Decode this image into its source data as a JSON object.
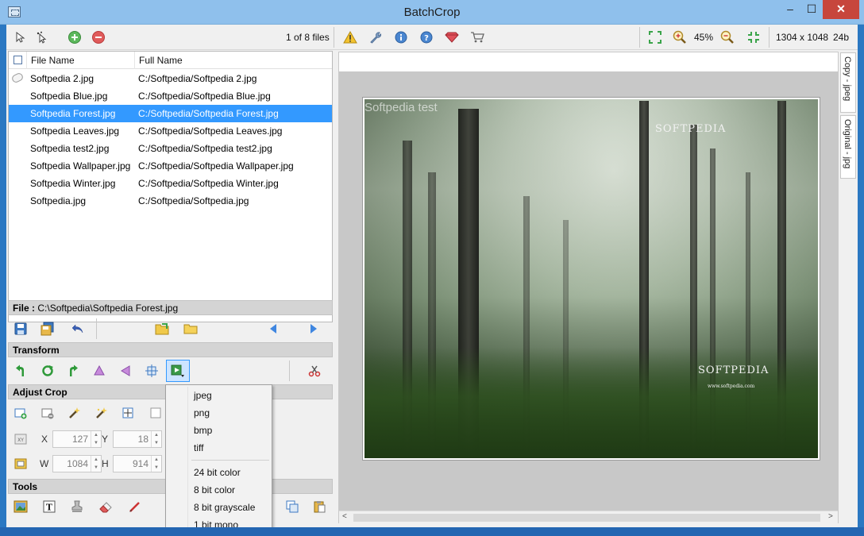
{
  "window": {
    "title": "BatchCrop",
    "minimize": "–",
    "maximize": "☐",
    "close": "✕"
  },
  "toolbar": {
    "file_count": "1 of 8 files",
    "zoom": "45%",
    "image_size": "1304 x 1048",
    "bit_depth": "24b",
    "icons": [
      "select-arrow-icon",
      "magic-select-icon",
      "add-icon",
      "remove-icon",
      "warning-icon",
      "wrench-icon",
      "info-icon",
      "help-icon",
      "gem-icon",
      "cart-icon",
      "fit-icon",
      "zoom-in-icon",
      "zoom-out-icon",
      "actual-size-icon"
    ]
  },
  "file_list": {
    "columns": [
      "File Name",
      "Full Name"
    ],
    "rows": [
      {
        "name": "Softpedia 2.jpg",
        "full": "C:/Softpedia/Softpedia 2.jpg"
      },
      {
        "name": "Softpedia Blue.jpg",
        "full": "C:/Softpedia/Softpedia Blue.jpg"
      },
      {
        "name": "Softpedia Forest.jpg",
        "full": "C:/Softpedia/Softpedia Forest.jpg",
        "selected": true
      },
      {
        "name": "Softpedia Leaves.jpg",
        "full": "C:/Softpedia/Softpedia Leaves.jpg"
      },
      {
        "name": "Softpedia test2.jpg",
        "full": "C:/Softpedia/Softpedia test2.jpg"
      },
      {
        "name": "Softpedia Wallpaper.jpg",
        "full": "C:/Softpedia/Softpedia Wallpaper.jpg"
      },
      {
        "name": "Softpedia Winter.jpg",
        "full": "C:/Softpedia/Softpedia Winter.jpg"
      },
      {
        "name": "Softpedia.jpg",
        "full": "C:/Softpedia/Softpedia.jpg"
      }
    ]
  },
  "file_bar": {
    "label": "File :",
    "path": "C:\\Softpedia\\Softpedia Forest.jpg"
  },
  "sections": {
    "transform": "Transform",
    "adjust_crop": "Adjust Crop",
    "tools": "Tools"
  },
  "crop": {
    "x_label": "X",
    "x_value": "127",
    "y_label": "Y",
    "y_value": "18",
    "w_label": "W",
    "w_value": "1084",
    "h_label": "H",
    "h_value": "914"
  },
  "format_menu": {
    "formats": [
      "jpeg",
      "png",
      "bmp",
      "tiff"
    ],
    "color_modes": [
      "24 bit color",
      "8 bit color",
      "8 bit grayscale",
      "1 bit mono"
    ]
  },
  "preview": {
    "watermark_test": "Softpedia test",
    "logo_top": "SOFTPEDIA",
    "logo_bottom": "SOFTPEDIA",
    "url": "www.softpedia.com",
    "tabs": [
      "Copy - jpeg",
      "Original - jpg"
    ]
  },
  "colors": {
    "selection": "#3399ff",
    "title_bar": "#8fc0ec",
    "close_button": "#c7463c"
  }
}
